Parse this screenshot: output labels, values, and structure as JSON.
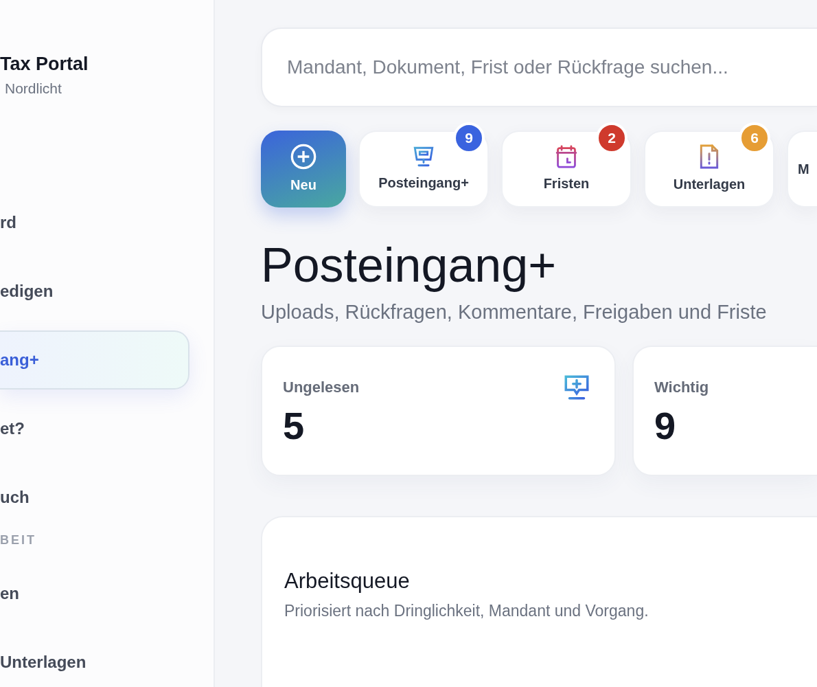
{
  "sidebar": {
    "brand": {
      "title": "Tax Portal",
      "subtitle": "Nordlicht"
    },
    "items": [
      {
        "kind": "item",
        "label": "rd",
        "selected": false
      },
      {
        "kind": "item",
        "label": "edigen",
        "selected": false
      },
      {
        "kind": "item",
        "label": "ang+",
        "selected": true
      },
      {
        "kind": "item",
        "label": "et?",
        "selected": false
      },
      {
        "kind": "item",
        "label": "uch",
        "selected": false
      },
      {
        "kind": "section",
        "label": "BEIT"
      },
      {
        "kind": "item",
        "label": "en",
        "selected": false
      },
      {
        "kind": "item",
        "label": "Unterlagen",
        "selected": false
      }
    ]
  },
  "search": {
    "placeholder": "Mandant, Dokument, Frist oder Rückfrage suchen..."
  },
  "quick_actions": [
    {
      "kind": "new",
      "label": "Neu"
    },
    {
      "kind": "inbox",
      "label": "Posteingang+",
      "badge": "9",
      "color": "#3a63df"
    },
    {
      "kind": "calendar",
      "label": "Fristen",
      "badge": "2",
      "color": "#cf3a2d"
    },
    {
      "kind": "document",
      "label": "Unterlagen",
      "badge": "6",
      "color": "#e69d34"
    },
    {
      "kind": "cut",
      "label": "M"
    }
  ],
  "page": {
    "title": "Posteingang+",
    "subtitle": "Uploads, Rückfragen, Kommentare, Freigaben und Friste"
  },
  "stats": [
    {
      "label": "Ungelesen",
      "value": "5",
      "icon": true
    },
    {
      "label": "Wichtig",
      "value": "9",
      "icon": false
    }
  ],
  "queue": {
    "title": "Arbeitsqueue",
    "subtitle": "Priorisiert nach Dringlichkeit, Mandant und Vorgang."
  }
}
